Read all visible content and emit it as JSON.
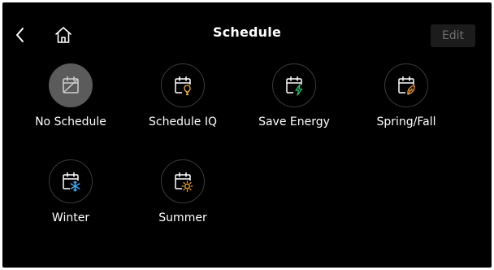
{
  "header": {
    "title": "Schedule",
    "edit_label": "Edit",
    "back_icon": "chevron-left-icon",
    "home_icon": "home-icon"
  },
  "colors": {
    "background": "#000000",
    "tile_selected": "#5b5b5b",
    "lightning": "#27c46b",
    "bulb": "#f5b33c",
    "leaf": "#e8932f",
    "snow": "#3ea7ee",
    "sun": "#f5a623",
    "edit_disabled_text": "#6f6f6f"
  },
  "schedules": [
    {
      "label": "No Schedule",
      "icon": "calendar-crossed-icon",
      "selected": true
    },
    {
      "label": "Schedule IQ",
      "icon": "calendar-bulb-icon",
      "selected": false
    },
    {
      "label": "Save Energy",
      "icon": "calendar-lightning-icon",
      "selected": false
    },
    {
      "label": "Spring/Fall",
      "icon": "calendar-leaf-icon",
      "selected": false
    },
    {
      "label": "Winter",
      "icon": "calendar-snowflake-icon",
      "selected": false
    },
    {
      "label": "Summer",
      "icon": "calendar-sun-icon",
      "selected": false
    }
  ]
}
